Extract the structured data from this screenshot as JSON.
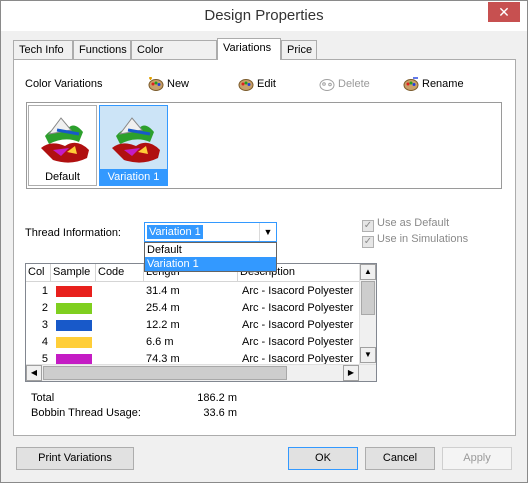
{
  "window": {
    "title": "Design Properties",
    "close": "✕"
  },
  "tabs": [
    "Tech Info",
    "Functions",
    "Color Sequence",
    "Variations",
    "Price"
  ],
  "active_tab": "Variations",
  "color_variations_label": "Color Variations",
  "toolbar": {
    "new": "New",
    "edit": "Edit",
    "delete": "Delete",
    "rename": "Rename"
  },
  "variations": [
    "Default",
    "Variation 1"
  ],
  "selected_variation": "Variation 1",
  "thread_info": {
    "label": "Thread Information:",
    "value": "Variation 1",
    "options": [
      "Default",
      "Variation 1"
    ]
  },
  "checkboxes": {
    "use_as_default": "Use as Default",
    "use_in_simulations": "Use in Simulations"
  },
  "table": {
    "columns": [
      "Col",
      "Sample",
      "Code",
      "Length",
      "Description"
    ],
    "rows": [
      {
        "col": "1",
        "color": "#e8201c",
        "code": "",
        "length": "31.4 m",
        "description": "Arc - Isacord Polyester"
      },
      {
        "col": "2",
        "color": "#7fcf1f",
        "code": "",
        "length": "25.4 m",
        "description": "Arc - Isacord Polyester"
      },
      {
        "col": "3",
        "color": "#1859c9",
        "code": "",
        "length": "12.2 m",
        "description": "Arc - Isacord Polyester"
      },
      {
        "col": "4",
        "color": "#ffce38",
        "code": "",
        "length": "6.6 m",
        "description": "Arc - Isacord Polyester"
      },
      {
        "col": "5",
        "color": "#c41cc4",
        "code": "",
        "length": "74.3 m",
        "description": "Arc - Isacord Polyester"
      }
    ]
  },
  "totals": {
    "total_label": "Total",
    "total_value": "186.2 m",
    "bobbin_label": "Bobbin Thread Usage:",
    "bobbin_value": "33.6 m"
  },
  "buttons": {
    "print": "Print Variations",
    "ok": "OK",
    "cancel": "Cancel",
    "apply": "Apply"
  }
}
